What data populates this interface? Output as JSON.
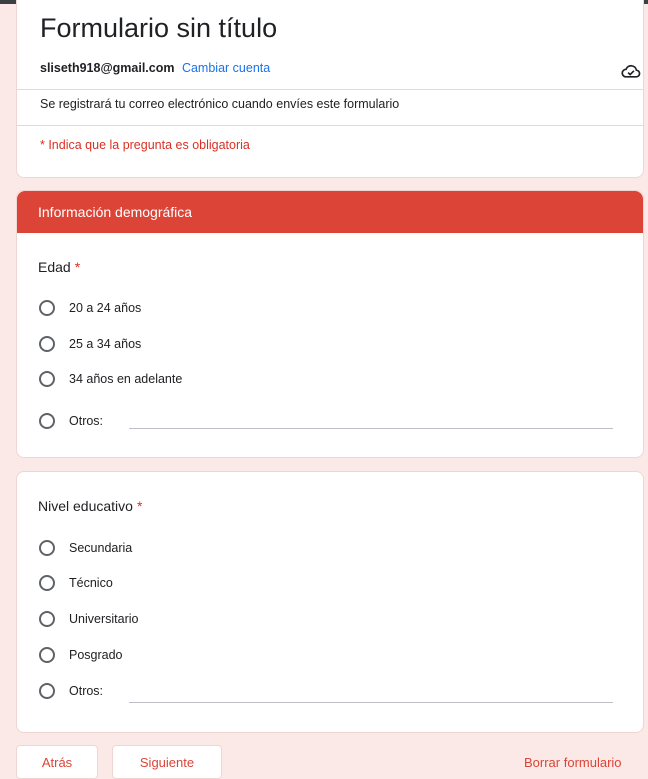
{
  "form": {
    "title": "Formulario sin título",
    "account_email": "sliseth918@gmail.com",
    "switch_account": "Cambiar cuenta",
    "record_note": "Se registrará tu correo electrónico cuando envíes este formulario",
    "required_note": "* Indica que la pregunta es obligatoria"
  },
  "section": {
    "title": "Información demográfica"
  },
  "questions": [
    {
      "title": "Edad",
      "required_mark": "*",
      "options": [
        "20 a 24 años",
        "25 a 34 años",
        "34 años en adelante",
        "Otros:"
      ]
    },
    {
      "title": "Nivel educativo",
      "required_mark": "*",
      "options": [
        "Secundaria",
        "Técnico",
        "Universitario",
        "Posgrado",
        "Otros:"
      ]
    }
  ],
  "nav": {
    "back": "Atrás",
    "next": "Siguiente",
    "clear": "Borrar formulario"
  },
  "icons": {
    "cloud": "cloud-check-icon"
  },
  "colors": {
    "accent": "#db4437",
    "link": "#1a73e8",
    "required": "#d93025",
    "page_background": "#fbe9e7"
  }
}
